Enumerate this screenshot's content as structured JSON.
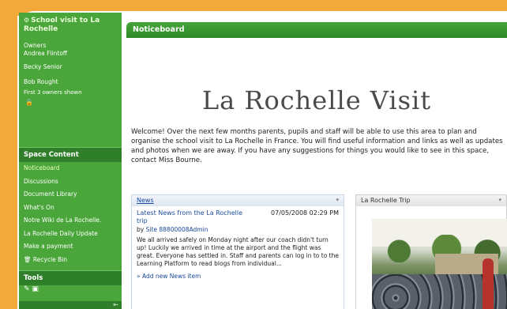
{
  "sidebar": {
    "space_title": "School visit to La Rochelle",
    "owners_heading": "Owners",
    "owners": [
      "Andrea Flintoff",
      "Becky Senior",
      "Bob Rought"
    ],
    "owners_shown_note": "First 3 owners shown",
    "space_content_heading": "Space Content",
    "links": [
      "Noticeboard",
      "Discussions",
      "Document Library",
      "What's On",
      "Notre Wiki de La Rochelle.",
      "La Rochelle Daily Update",
      "Make a payment",
      "Recycle Bin"
    ],
    "tools_heading": "Tools"
  },
  "main": {
    "noticeboard_label": "Noticeboard",
    "page_title": "La Rochelle Visit",
    "welcome_text": "Welcome! Over the next few months parents, pupils and staff will be able to use this area to plan and organise the school visit to La Rochelle in France. You will find useful information and links as well as updates and photos when we are away. If you have any suggestions for things you would like to see in this space, contact Miss Bourne."
  },
  "news": {
    "panel_title": "News",
    "item_title": "Latest News from the La Rochelle trip",
    "item_date": "07/05/2008 02:29 PM",
    "by_label": "by",
    "author": "Site 88800008Admin",
    "body": "We all arrived safely on Monday night after our coach didn't turn up! Luckily we arrived in time at the airport and the flight was great. Everyone has settled in. Staff and parents can log in to to the Learning Platform to read blogs from individual...",
    "add_link": "Add new News item"
  },
  "trip": {
    "panel_title": "La Rochelle Trip"
  },
  "colors": {
    "frame_orange": "#f2a93a",
    "sidebar_green": "#4aa63a",
    "section_green": "#2f7f2a",
    "link_blue": "#1a4a9c"
  }
}
